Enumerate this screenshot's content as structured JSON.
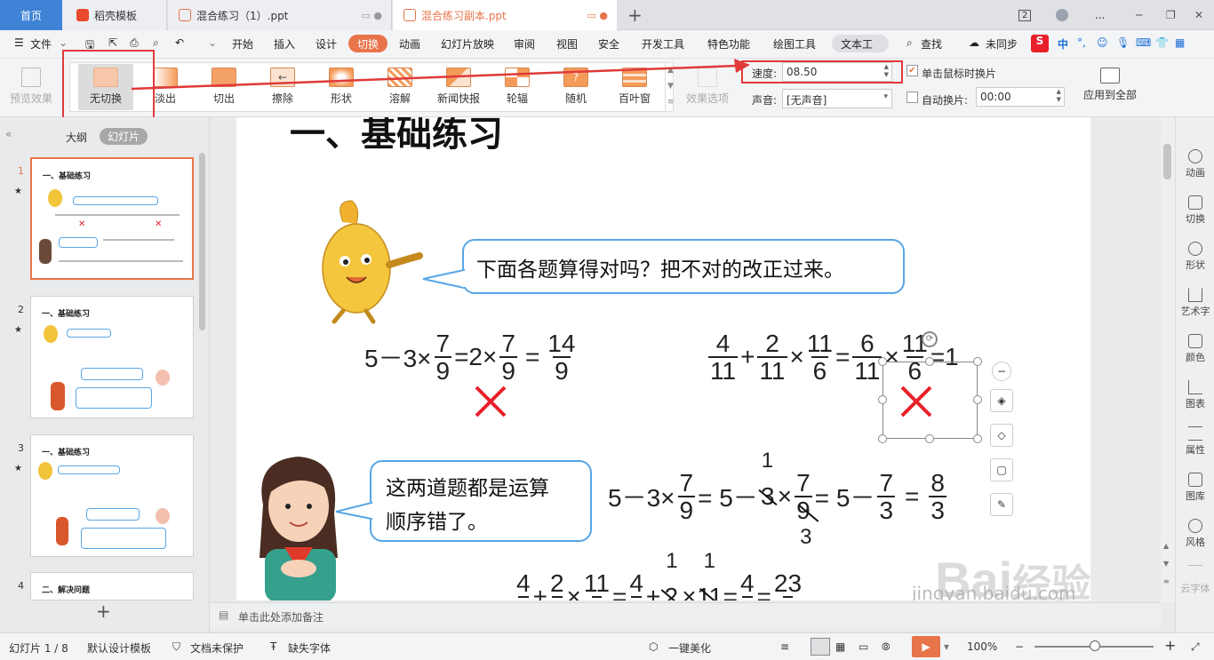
{
  "tabs": {
    "home": "首页",
    "template": "稻壳模板",
    "doc1": "混合练习（1）.ppt",
    "doc2": "混合练习副本.ppt",
    "badge": "2",
    "more": "..."
  },
  "menu": {
    "file": "文件",
    "items": [
      "开始",
      "插入",
      "设计",
      "切换",
      "动画",
      "幻灯片放映",
      "审阅",
      "视图",
      "安全",
      "开发工具",
      "特色功能",
      "绘图工具",
      "文本工"
    ],
    "active": "切换",
    "search": "查找",
    "sync": "未同步",
    "ime": "中"
  },
  "ribbon": {
    "preview": "预览效果",
    "transitions": [
      "无切换",
      "淡出",
      "切出",
      "擦除",
      "形状",
      "溶解",
      "新闻快报",
      "轮辐",
      "随机",
      "百叶窗"
    ],
    "effect_options": "效果选项",
    "speed_label": "速度:",
    "speed_value": "08.50",
    "sound_label": "声音:",
    "sound_value": "[无声音]",
    "on_click_label": "单击鼠标时换片",
    "auto_label": "自动换片:",
    "auto_value": "00:00",
    "apply_all": "应用到全部"
  },
  "leftpanel": {
    "outline_tab": "大纲",
    "slides_tab": "幻灯片",
    "slides": [
      {
        "no": "1",
        "title": "一、基础练习"
      },
      {
        "no": "2",
        "title": "一、基础练习"
      },
      {
        "no": "3",
        "title": "一、基础练习"
      },
      {
        "no": "4",
        "title": "二、解决问题"
      }
    ]
  },
  "slide": {
    "heading": "一、基础练习",
    "bubble1": "下面各题算得对吗？把不对的改正过来。",
    "bubble2_line1": "这两道题都是运算",
    "bubble2_line2": "顺序错了。",
    "eq1": {
      "a": "5－3×",
      "f1n": "7",
      "f1d": "9",
      "b": "=2×",
      "f2n": "7",
      "f2d": "9",
      "c": "=",
      "f3n": "14",
      "f3d": "9"
    },
    "eq2": {
      "f1n": "4",
      "f1d": "11",
      "p": "+",
      "f2n": "2",
      "f2d": "11",
      "m": "×",
      "f3n": "11",
      "f3d": "6",
      "e": "=",
      "f4n": "6",
      "f4d": "11",
      "m2": "×",
      "f5n": "11",
      "f5d": "6",
      "r": "=1"
    },
    "eq3": {
      "a": "5－3×",
      "f1n": "7",
      "f1d": "9",
      "b": "= 5－",
      "c1": "1",
      "c2": "3",
      "x": "×",
      "f2n": "7",
      "f2d": "9",
      "c3": "3",
      "e": "= 5－",
      "f3n": "7",
      "f3d": "3",
      "e2": "=",
      "f4n": "8",
      "f4d": "3"
    },
    "eq4": {
      "f1n": "4",
      "p": "+",
      "f2n": "2",
      "m": "×",
      "f3n": "11",
      "e": "=",
      "f4n": "4",
      "p2": "+",
      "c1": "1",
      "c2": "2",
      "m2": "×",
      "c3": "1",
      "c4": "11",
      "e2": "=",
      "f5n": "4",
      "e3": "=",
      "f6n": "23"
    }
  },
  "notes": "单击此处添加备注",
  "rightbar": [
    "动画",
    "切换",
    "形状",
    "艺术字",
    "颜色",
    "图表",
    "属性",
    "图库",
    "风格",
    "云字体"
  ],
  "status": {
    "slide_pos": "幻灯片 1 / 8",
    "theme": "默认设计模板",
    "protect": "文档未保护",
    "font": "缺失字体",
    "beautify": "一键美化",
    "zoom": "100%"
  },
  "watermark": {
    "brand": "Bai",
    "cn": "经验",
    "url": "jingyan.baidu.com"
  },
  "colors": {
    "accent": "#e8744a",
    "highlight_box": "#e03a3a",
    "bubble_border": "#58a6e6",
    "wrong": "#e8202a"
  }
}
